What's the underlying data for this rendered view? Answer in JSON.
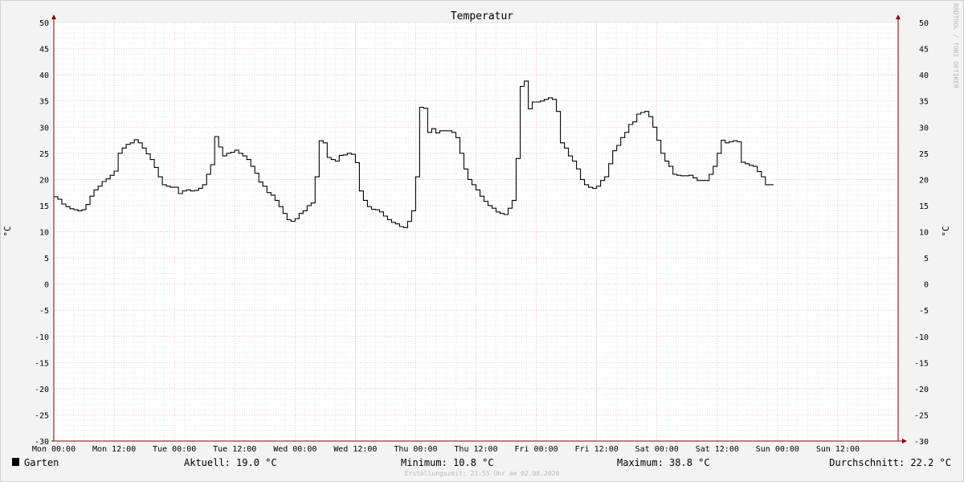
{
  "colors": {
    "background": "#f3f3f3",
    "canvas": "#ffffff",
    "grid_minor": "#dddddd",
    "grid_major": "#e8a0a0",
    "axis": "#8b0000",
    "line": "#000000"
  },
  "chart_data": {
    "type": "line",
    "title": "Temperatur",
    "ylabel": "°C",
    "ylim": [
      -30,
      50
    ],
    "yticks": [
      50,
      45,
      40,
      35,
      30,
      25,
      20,
      15,
      10,
      5,
      0,
      -5,
      -10,
      -15,
      -20,
      -25,
      -30
    ],
    "xlim": [
      0,
      168
    ],
    "x_unit": "hours",
    "xticks": [
      {
        "x": 0,
        "label": "Mon 00:00"
      },
      {
        "x": 12,
        "label": "Mon 12:00"
      },
      {
        "x": 24,
        "label": "Tue 00:00"
      },
      {
        "x": 36,
        "label": "Tue 12:00"
      },
      {
        "x": 48,
        "label": "Wed 00:00"
      },
      {
        "x": 60,
        "label": "Wed 12:00"
      },
      {
        "x": 72,
        "label": "Thu 00:00"
      },
      {
        "x": 84,
        "label": "Thu 12:00"
      },
      {
        "x": 96,
        "label": "Fri 00:00"
      },
      {
        "x": 108,
        "label": "Fri 12:00"
      },
      {
        "x": 120,
        "label": "Sat 00:00"
      },
      {
        "x": 132,
        "label": "Sat 12:00"
      },
      {
        "x": 144,
        "label": "Sun 00:00"
      },
      {
        "x": 156,
        "label": "Sun 12:00"
      }
    ],
    "grid": true,
    "series": [
      {
        "name": "Garten",
        "color": "#000000",
        "step": true,
        "points": [
          [
            0,
            16.7
          ],
          [
            0.8,
            16.2
          ],
          [
            1.6,
            15.3
          ],
          [
            2.4,
            14.8
          ],
          [
            3.2,
            14.4
          ],
          [
            4,
            14.2
          ],
          [
            4.8,
            14.0
          ],
          [
            5.6,
            14.2
          ],
          [
            6.4,
            15.2
          ],
          [
            7.2,
            16.8
          ],
          [
            8,
            18.0
          ],
          [
            8.8,
            18.7
          ],
          [
            9.6,
            19.6
          ],
          [
            10.4,
            20.1
          ],
          [
            11.2,
            20.8
          ],
          [
            12,
            21.6
          ],
          [
            12.8,
            25.0
          ],
          [
            13.6,
            26.0
          ],
          [
            14.4,
            26.7
          ],
          [
            15.2,
            27.0
          ],
          [
            16,
            27.6
          ],
          [
            16.8,
            27.0
          ],
          [
            17.6,
            26.0
          ],
          [
            18.4,
            24.9
          ],
          [
            19.2,
            23.8
          ],
          [
            20,
            22.3
          ],
          [
            20.8,
            20.5
          ],
          [
            21.6,
            19.0
          ],
          [
            22.4,
            18.7
          ],
          [
            23.2,
            18.5
          ],
          [
            24,
            18.5
          ],
          [
            24.8,
            17.3
          ],
          [
            25.6,
            17.8
          ],
          [
            26.4,
            18.0
          ],
          [
            27.2,
            17.8
          ],
          [
            28,
            17.9
          ],
          [
            28.8,
            18.3
          ],
          [
            29.6,
            19.0
          ],
          [
            30.4,
            21.0
          ],
          [
            31.2,
            22.8
          ],
          [
            32,
            28.2
          ],
          [
            32.8,
            26.2
          ],
          [
            33.6,
            24.5
          ],
          [
            34.4,
            25.0
          ],
          [
            35.2,
            25.2
          ],
          [
            36,
            25.6
          ],
          [
            36.8,
            25.0
          ],
          [
            37.6,
            24.5
          ],
          [
            38.4,
            23.8
          ],
          [
            39.2,
            22.5
          ],
          [
            40,
            21.2
          ],
          [
            40.8,
            19.5
          ],
          [
            41.6,
            18.7
          ],
          [
            42.4,
            17.5
          ],
          [
            43.2,
            17.0
          ],
          [
            44,
            16.0
          ],
          [
            44.8,
            14.8
          ],
          [
            45.6,
            13.5
          ],
          [
            46.4,
            12.3
          ],
          [
            47.2,
            12.0
          ],
          [
            48,
            12.5
          ],
          [
            48.8,
            13.5
          ],
          [
            49.6,
            14.0
          ],
          [
            50.4,
            15.0
          ],
          [
            51.2,
            15.5
          ],
          [
            52,
            20.5
          ],
          [
            52.8,
            27.4
          ],
          [
            53.6,
            27.0
          ],
          [
            54.4,
            24.2
          ],
          [
            55.2,
            23.8
          ],
          [
            56,
            23.5
          ],
          [
            56.8,
            24.6
          ],
          [
            57.6,
            24.7
          ],
          [
            58.4,
            25.0
          ],
          [
            59.2,
            24.8
          ],
          [
            60,
            23.2
          ],
          [
            60.8,
            17.8
          ],
          [
            61.6,
            16.0
          ],
          [
            62.4,
            14.8
          ],
          [
            63.2,
            14.3
          ],
          [
            64,
            14.2
          ],
          [
            64.8,
            13.8
          ],
          [
            65.6,
            13.0
          ],
          [
            66.4,
            12.3
          ],
          [
            67.2,
            11.8
          ],
          [
            68,
            11.5
          ],
          [
            68.8,
            11.0
          ],
          [
            69.6,
            10.8
          ],
          [
            70.4,
            12.0
          ],
          [
            71.2,
            14.0
          ],
          [
            72,
            20.5
          ],
          [
            72.8,
            33.8
          ],
          [
            73.6,
            33.6
          ],
          [
            74.4,
            29.0
          ],
          [
            75.2,
            29.7
          ],
          [
            76,
            28.9
          ],
          [
            76.8,
            29.3
          ],
          [
            77.6,
            29.3
          ],
          [
            78.4,
            29.3
          ],
          [
            79.2,
            29.0
          ],
          [
            80,
            28.0
          ],
          [
            80.8,
            25.0
          ],
          [
            81.6,
            22.0
          ],
          [
            82.4,
            20.0
          ],
          [
            83.2,
            19.0
          ],
          [
            84,
            18.0
          ],
          [
            84.8,
            16.8
          ],
          [
            85.6,
            15.8
          ],
          [
            86.4,
            15.0
          ],
          [
            87.2,
            14.5
          ],
          [
            88,
            13.8
          ],
          [
            88.8,
            13.5
          ],
          [
            89.6,
            13.3
          ],
          [
            90.4,
            14.5
          ],
          [
            91.2,
            16.0
          ],
          [
            92,
            24.0
          ],
          [
            92.8,
            37.8
          ],
          [
            93.6,
            38.8
          ],
          [
            94.4,
            33.5
          ],
          [
            95.2,
            34.8
          ],
          [
            96,
            34.8
          ],
          [
            96.8,
            35.0
          ],
          [
            97.6,
            35.3
          ],
          [
            98.4,
            35.6
          ],
          [
            99.2,
            35.3
          ],
          [
            100,
            33.0
          ],
          [
            100.8,
            27.0
          ],
          [
            101.6,
            26.0
          ],
          [
            102.4,
            24.5
          ],
          [
            103.2,
            23.5
          ],
          [
            104,
            22.0
          ],
          [
            104.8,
            20.0
          ],
          [
            105.6,
            19.0
          ],
          [
            106.4,
            18.5
          ],
          [
            107.2,
            18.3
          ],
          [
            108,
            18.7
          ],
          [
            108.8,
            19.8
          ],
          [
            109.6,
            20.5
          ],
          [
            110.4,
            23.0
          ],
          [
            111.2,
            25.5
          ],
          [
            112,
            26.5
          ],
          [
            112.8,
            28.0
          ],
          [
            113.6,
            29.0
          ],
          [
            114.4,
            30.5
          ],
          [
            115.2,
            31.0
          ],
          [
            116,
            32.5
          ],
          [
            116.8,
            32.8
          ],
          [
            117.6,
            33.0
          ],
          [
            118.4,
            32.0
          ],
          [
            119.2,
            30.0
          ],
          [
            120,
            27.5
          ],
          [
            120.8,
            25.0
          ],
          [
            121.6,
            23.5
          ],
          [
            122.4,
            22.5
          ],
          [
            123.2,
            21.0
          ],
          [
            124,
            20.8
          ],
          [
            124.8,
            20.7
          ],
          [
            125.6,
            20.7
          ],
          [
            126.4,
            20.8
          ],
          [
            127.2,
            20.3
          ],
          [
            128,
            19.8
          ],
          [
            128.8,
            19.8
          ],
          [
            129.6,
            19.8
          ],
          [
            130.4,
            21.0
          ],
          [
            131.2,
            22.5
          ],
          [
            132,
            25.0
          ],
          [
            132.8,
            27.5
          ],
          [
            133.6,
            27.0
          ],
          [
            134.4,
            27.2
          ],
          [
            135.2,
            27.4
          ],
          [
            136,
            27.2
          ],
          [
            136.8,
            23.3
          ],
          [
            137.6,
            23.0
          ],
          [
            138.4,
            22.7
          ],
          [
            139.2,
            22.5
          ],
          [
            140,
            21.5
          ],
          [
            140.8,
            20.5
          ],
          [
            141.6,
            19.0
          ],
          [
            142.4,
            19.0
          ]
        ]
      }
    ]
  },
  "watermark": "RRDTOOL / TOBI OETIKER",
  "legend": {
    "series_name": "Garten",
    "aktuell": "Aktuell: 19.0 °C",
    "minimum": "Minimum: 10.8 °C",
    "maximum": "Maximum: 38.8 °C",
    "durchschnitt": "Durchschnitt: 22.2 °C",
    "footer": "Erstellungszeit: 23:55 Uhr am 02.08.2020"
  }
}
